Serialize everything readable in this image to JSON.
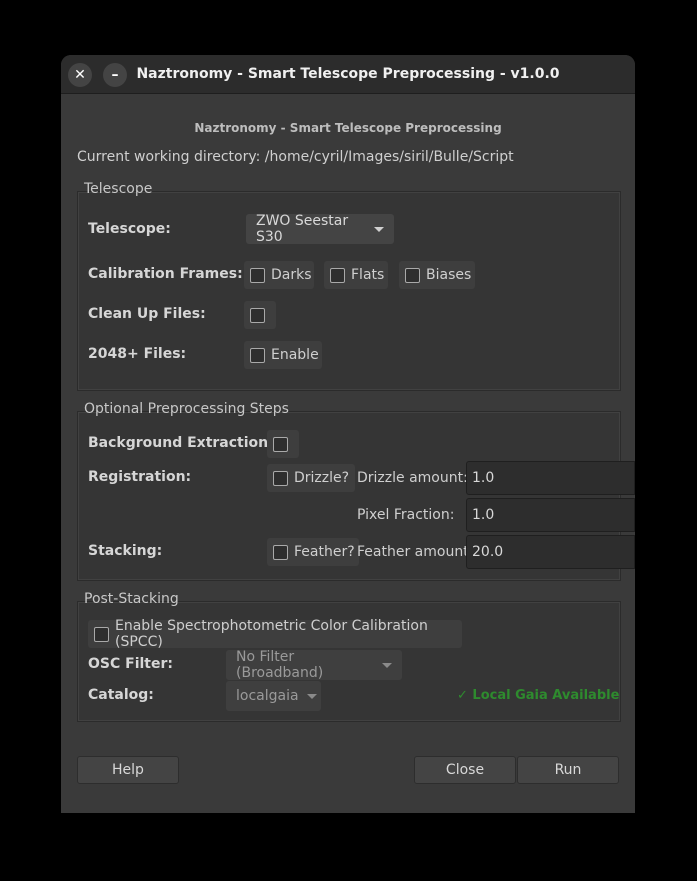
{
  "window": {
    "title": "Naztronomy - Smart Telescope Preprocessing - v1.0.0",
    "close_glyph": "✕",
    "minimize_glyph": "–"
  },
  "header": {
    "title": "Naztronomy - Smart Telescope Preprocessing",
    "cwd": "Current working directory: /home/cyril/Images/siril/Bulle/Script"
  },
  "telescope_section": {
    "label": "Telescope",
    "telescope_label": "Telescope:",
    "telescope_value": "ZWO Seestar S30",
    "calibration_label": "Calibration Frames:",
    "darks": "Darks",
    "flats": "Flats",
    "biases": "Biases",
    "cleanup_label": "Clean Up Files:",
    "files2048_label": "2048+ Files:",
    "enable": "Enable"
  },
  "optional_section": {
    "label": "Optional Preprocessing Steps",
    "background_label": "Background Extraction:",
    "registration_label": "Registration:",
    "drizzle": "Drizzle?",
    "drizzle_amount_label": "Drizzle amount:",
    "drizzle_amount_value": "1.0",
    "pixel_fraction_label": "Pixel Fraction:",
    "pixel_fraction_value": "1.0",
    "stacking_label": "Stacking:",
    "feather": "Feather?",
    "feather_amount_label": "Feather amount:",
    "feather_amount_value": "20.0"
  },
  "post_section": {
    "label": "Post-Stacking",
    "spcc": "Enable Spectrophotometric Color Calibration (SPCC)",
    "osc_label": "OSC Filter:",
    "osc_value": "No Filter (Broadband)",
    "catalog_label": "Catalog:",
    "catalog_value": "localgaia",
    "status": "✓ Local Gaia Available",
    "status_color": "#2e8b2e"
  },
  "buttons": {
    "help": "Help",
    "close": "Close",
    "run": "Run"
  }
}
